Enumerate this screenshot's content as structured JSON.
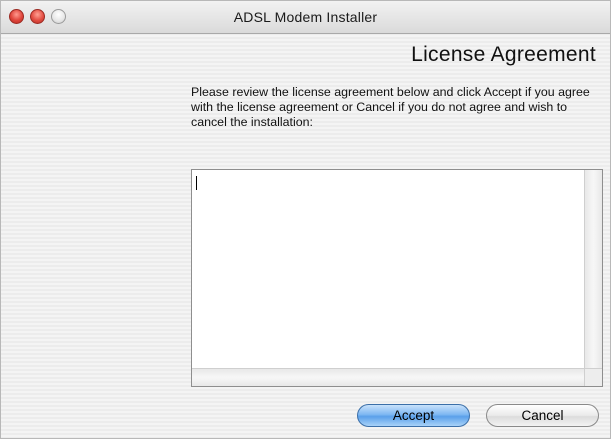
{
  "window": {
    "title": "ADSL Modem Installer"
  },
  "page": {
    "heading": "License Agreement",
    "description": "Please review the license agreement below and click Accept if you agree with the license agreement or Cancel if you do not agree and wish to cancel the installation:"
  },
  "license": {
    "text": ""
  },
  "buttons": {
    "accept_label": "Accept",
    "cancel_label": "Cancel"
  },
  "colors": {
    "default_button": "#7fb8f2",
    "close_button": "#e0443a"
  }
}
